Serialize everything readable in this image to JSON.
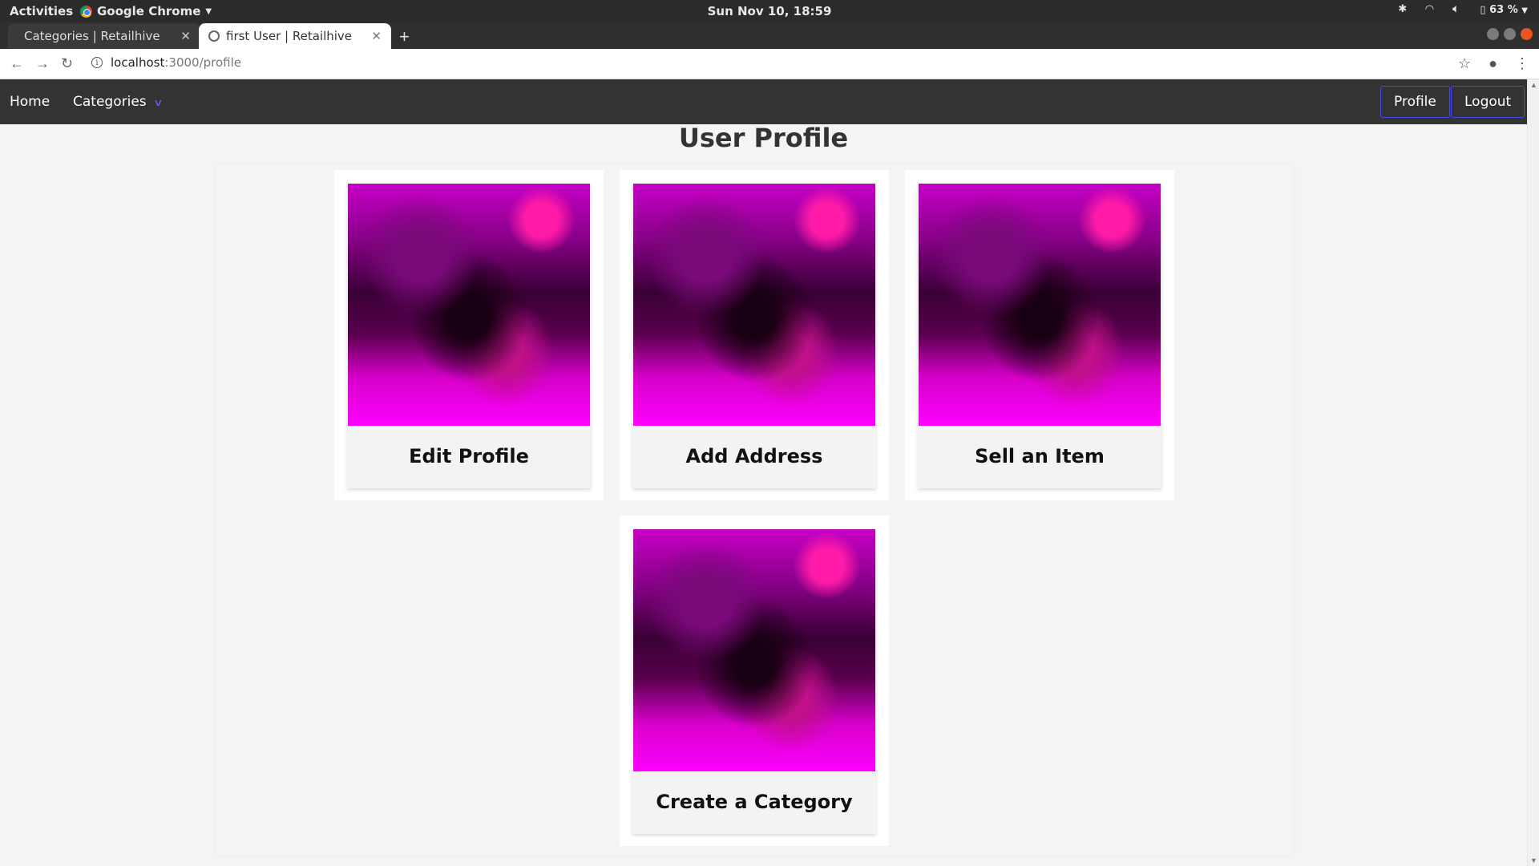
{
  "os": {
    "activities": "Activities",
    "app_name": "Google Chrome",
    "clock": "Sun Nov 10, 18:59",
    "battery": "63 %"
  },
  "browser": {
    "tabs": [
      {
        "title": "Categories | Retailhive"
      },
      {
        "title": "first User | Retailhive"
      }
    ],
    "url_host": "localhost",
    "url_path": ":3000/profile"
  },
  "navbar": {
    "home": "Home",
    "categories": "Categories",
    "profile": "Profile",
    "logout": "Logout"
  },
  "page": {
    "title": "User Profile"
  },
  "cards": [
    {
      "label": "Edit Profile"
    },
    {
      "label": "Add Address"
    },
    {
      "label": "Sell an Item"
    },
    {
      "label": "Create a Category"
    }
  ]
}
